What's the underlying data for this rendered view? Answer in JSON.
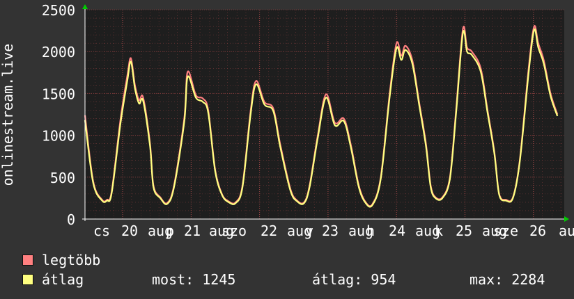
{
  "chart_data": {
    "type": "line",
    "ylabel": "onlinestream.live",
    "ylim": [
      0,
      2500
    ],
    "yticks": [
      0,
      500,
      1000,
      1500,
      2000,
      2500
    ],
    "grid": true,
    "x_tick_labels": [
      "cs",
      "20",
      "aug",
      "p",
      "21",
      "aug",
      "szo",
      "22",
      "aug",
      "v",
      "23",
      "aug",
      "h",
      "24",
      "aug",
      "k",
      "25",
      "aug",
      "sze",
      "26",
      "au"
    ],
    "colors": {
      "background": "#333333",
      "plot_area": "#1e1e1e",
      "grid": "#7a3a3a",
      "legtobb": "#ff8080",
      "atlag": "#ffff80",
      "axis_arrow": "#00cc00"
    },
    "series": [
      {
        "name": "legtöbb",
        "color": "#ff8080",
        "keypoints": [
          [
            0.0,
            1240
          ],
          [
            0.12,
            450
          ],
          [
            0.25,
            230
          ],
          [
            0.32,
            230
          ],
          [
            0.39,
            330
          ],
          [
            0.52,
            1200
          ],
          [
            0.62,
            1720
          ],
          [
            0.67,
            1920
          ],
          [
            0.73,
            1600
          ],
          [
            0.79,
            1420
          ],
          [
            0.85,
            1450
          ],
          [
            0.95,
            900
          ],
          [
            1.0,
            400
          ],
          [
            1.1,
            260
          ],
          [
            1.2,
            190
          ],
          [
            1.3,
            400
          ],
          [
            1.45,
            1200
          ],
          [
            1.5,
            1760
          ],
          [
            1.62,
            1480
          ],
          [
            1.72,
            1440
          ],
          [
            1.8,
            1300
          ],
          [
            1.9,
            600
          ],
          [
            2.0,
            300
          ],
          [
            2.1,
            210
          ],
          [
            2.2,
            200
          ],
          [
            2.3,
            400
          ],
          [
            2.42,
            1300
          ],
          [
            2.5,
            1650
          ],
          [
            2.62,
            1400
          ],
          [
            2.75,
            1320
          ],
          [
            2.85,
            900
          ],
          [
            3.0,
            360
          ],
          [
            3.1,
            220
          ],
          [
            3.2,
            200
          ],
          [
            3.28,
            400
          ],
          [
            3.4,
            1000
          ],
          [
            3.52,
            1490
          ],
          [
            3.65,
            1150
          ],
          [
            3.78,
            1200
          ],
          [
            3.88,
            900
          ],
          [
            4.0,
            400
          ],
          [
            4.1,
            200
          ],
          [
            4.2,
            180
          ],
          [
            4.32,
            500
          ],
          [
            4.45,
            1500
          ],
          [
            4.55,
            2100
          ],
          [
            4.62,
            1950
          ],
          [
            4.68,
            2070
          ],
          [
            4.78,
            1900
          ],
          [
            4.88,
            1400
          ],
          [
            4.98,
            900
          ],
          [
            5.05,
            400
          ],
          [
            5.12,
            260
          ],
          [
            5.22,
            260
          ],
          [
            5.33,
            500
          ],
          [
            5.42,
            1300
          ],
          [
            5.52,
            2270
          ],
          [
            5.58,
            2050
          ],
          [
            5.65,
            2000
          ],
          [
            5.78,
            1800
          ],
          [
            5.88,
            1300
          ],
          [
            5.98,
            800
          ],
          [
            6.05,
            300
          ],
          [
            6.15,
            230
          ],
          [
            6.25,
            260
          ],
          [
            6.35,
            700
          ],
          [
            6.48,
            1800
          ],
          [
            6.56,
            2300
          ],
          [
            6.62,
            2100
          ],
          [
            6.7,
            1900
          ],
          [
            6.8,
            1500
          ],
          [
            6.9,
            1250
          ]
        ]
      },
      {
        "name": "átlag",
        "color": "#ffff80",
        "keypoints": [
          [
            0.0,
            1180
          ],
          [
            0.12,
            430
          ],
          [
            0.25,
            220
          ],
          [
            0.32,
            220
          ],
          [
            0.39,
            310
          ],
          [
            0.52,
            1150
          ],
          [
            0.62,
            1660
          ],
          [
            0.67,
            1880
          ],
          [
            0.73,
            1560
          ],
          [
            0.79,
            1380
          ],
          [
            0.85,
            1410
          ],
          [
            0.95,
            870
          ],
          [
            1.0,
            380
          ],
          [
            1.1,
            250
          ],
          [
            1.2,
            180
          ],
          [
            1.3,
            380
          ],
          [
            1.45,
            1160
          ],
          [
            1.5,
            1700
          ],
          [
            1.62,
            1450
          ],
          [
            1.72,
            1400
          ],
          [
            1.8,
            1270
          ],
          [
            1.9,
            580
          ],
          [
            2.0,
            290
          ],
          [
            2.1,
            200
          ],
          [
            2.2,
            190
          ],
          [
            2.3,
            380
          ],
          [
            2.42,
            1260
          ],
          [
            2.5,
            1610
          ],
          [
            2.62,
            1370
          ],
          [
            2.75,
            1290
          ],
          [
            2.85,
            870
          ],
          [
            3.0,
            340
          ],
          [
            3.1,
            210
          ],
          [
            3.2,
            190
          ],
          [
            3.28,
            380
          ],
          [
            3.4,
            970
          ],
          [
            3.52,
            1450
          ],
          [
            3.65,
            1120
          ],
          [
            3.78,
            1170
          ],
          [
            3.88,
            870
          ],
          [
            4.0,
            380
          ],
          [
            4.1,
            190
          ],
          [
            4.2,
            170
          ],
          [
            4.32,
            480
          ],
          [
            4.45,
            1460
          ],
          [
            4.55,
            2040
          ],
          [
            4.62,
            1900
          ],
          [
            4.68,
            2020
          ],
          [
            4.78,
            1860
          ],
          [
            4.88,
            1370
          ],
          [
            4.98,
            870
          ],
          [
            5.05,
            380
          ],
          [
            5.12,
            250
          ],
          [
            5.22,
            250
          ],
          [
            5.33,
            480
          ],
          [
            5.42,
            1260
          ],
          [
            5.52,
            2220
          ],
          [
            5.58,
            2000
          ],
          [
            5.65,
            1960
          ],
          [
            5.78,
            1760
          ],
          [
            5.88,
            1270
          ],
          [
            5.98,
            780
          ],
          [
            6.05,
            290
          ],
          [
            6.15,
            220
          ],
          [
            6.25,
            250
          ],
          [
            6.35,
            680
          ],
          [
            6.48,
            1750
          ],
          [
            6.56,
            2260
          ],
          [
            6.62,
            2050
          ],
          [
            6.7,
            1860
          ],
          [
            6.8,
            1470
          ],
          [
            6.9,
            1230
          ]
        ]
      }
    ],
    "x_range": [
      0,
      7.0
    ],
    "day_boundaries": [
      0.55,
      1.55,
      2.55,
      3.55,
      4.55,
      5.55,
      6.55
    ],
    "minor_x": [
      0.15,
      0.28,
      0.42,
      0.68,
      0.82,
      0.95,
      1.08,
      1.22,
      1.35,
      1.68,
      1.82,
      1.95,
      2.08,
      2.22,
      2.35,
      2.68,
      2.82,
      2.95,
      3.08,
      3.22,
      3.35,
      3.68,
      3.82,
      3.95,
      4.08,
      4.22,
      4.35,
      4.68,
      4.82,
      4.95,
      5.08,
      5.22,
      5.35,
      5.68,
      5.82,
      5.95,
      6.08,
      6.22,
      6.35,
      6.68,
      6.82,
      6.95
    ]
  },
  "legend": {
    "legtobb_label": "legtöbb",
    "atlag_label": "átlag",
    "most": "most: 1245",
    "atlag_stat": "átlag: 954",
    "max": "max: 2284"
  }
}
